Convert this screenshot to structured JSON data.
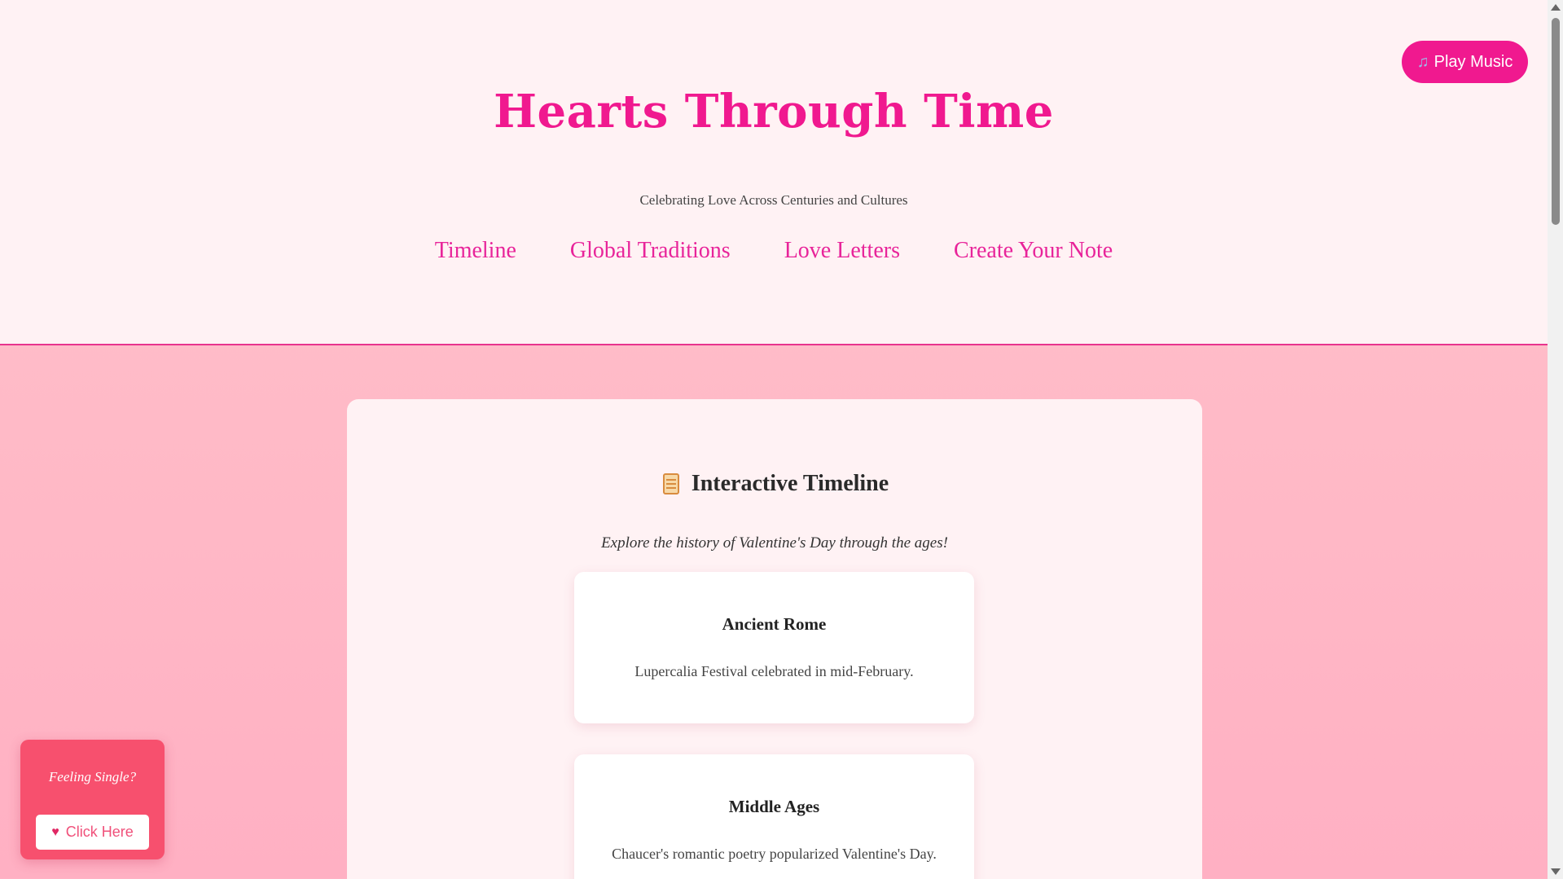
{
  "header": {
    "title": "Hearts Through Time",
    "subtitle": "Celebrating Love Across Centuries and Cultures",
    "nav": [
      {
        "label": "Timeline"
      },
      {
        "label": "Global Traditions"
      },
      {
        "label": "Love Letters"
      },
      {
        "label": "Create Your Note"
      }
    ]
  },
  "music": {
    "icon": "music-note-icon",
    "label": "Play Music"
  },
  "timeline_section": {
    "icon": "scroll-icon",
    "title": "Interactive Timeline",
    "description": "Explore the history of Valentine's Day through the ages!",
    "items": [
      {
        "era": "Ancient Rome",
        "event": "Lupercalia Festival celebrated in mid-February."
      },
      {
        "era": "Middle Ages",
        "event": "Chaucer's romantic poetry popularized Valentine's Day."
      }
    ]
  },
  "single_popup": {
    "question": "Feeling Single?",
    "button_icon": "broken-heart-icon",
    "button_label": "Click Here"
  },
  "colors": {
    "accent": "#f0198f",
    "header_bg": "#fff2f4",
    "popup_bg": "#f7506e",
    "page_bg": "#ffc2cb"
  }
}
